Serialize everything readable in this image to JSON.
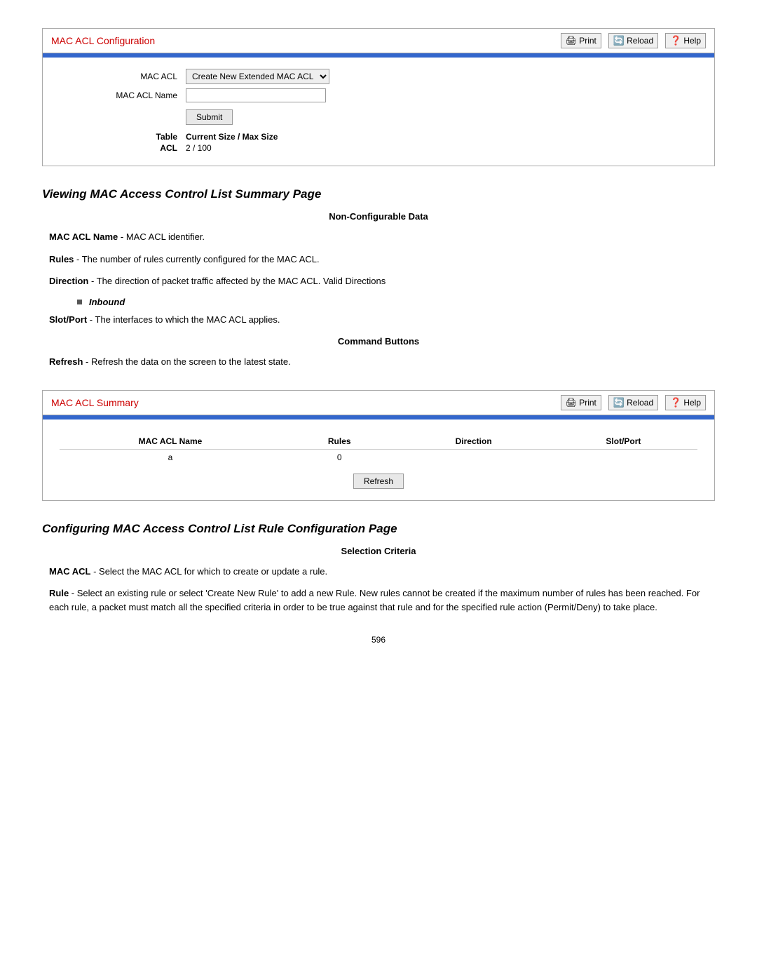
{
  "mac_acl_config_panel": {
    "title": "MAC ACL Configuration",
    "print_label": "Print",
    "reload_label": "Reload",
    "help_label": "Help",
    "mac_acl_label": "MAC ACL",
    "mac_acl_name_label": "MAC ACL Name",
    "mac_acl_select_default": "Create New Extended MAC ACL",
    "submit_label": "Submit",
    "table_label": "Table",
    "acl_label": "ACL",
    "table_header": "Current Size / Max Size",
    "table_value": "2 / 100"
  },
  "viewing_section": {
    "title": "Viewing MAC Access Control List Summary Page",
    "subtitle": "Non-Configurable Data",
    "items": [
      {
        "term": "MAC ACL Name",
        "definition": "MAC ACL identifier."
      },
      {
        "term": "Rules",
        "definition": "The number of rules currently configured for the MAC ACL."
      },
      {
        "term": "Direction",
        "definition": "The direction of packet traffic affected by the MAC ACL. Valid Directions"
      },
      {
        "term": "Slot/Port",
        "definition": "The interfaces to which the MAC ACL applies."
      }
    ],
    "bullets": [
      {
        "text": "Inbound"
      }
    ],
    "command_buttons_subtitle": "Command Buttons",
    "command_items": [
      {
        "term": "Refresh",
        "definition": "Refresh the data on the screen to the latest state."
      }
    ]
  },
  "mac_acl_summary_panel": {
    "title": "MAC ACL Summary",
    "print_label": "Print",
    "reload_label": "Reload",
    "help_label": "Help",
    "columns": [
      "MAC ACL Name",
      "Rules",
      "Direction",
      "Slot/Port"
    ],
    "rows": [
      {
        "name": "a",
        "rules": "0",
        "direction": "",
        "slot_port": ""
      }
    ],
    "refresh_label": "Refresh"
  },
  "configuring_section": {
    "title": "Configuring MAC Access Control List Rule Configuration Page",
    "subtitle": "Selection Criteria",
    "items": [
      {
        "term": "MAC ACL",
        "definition": "Select the MAC ACL for which to create or update a rule."
      },
      {
        "term": "Rule",
        "definition": "Select an existing rule or select 'Create New Rule' to add a new Rule. New rules cannot be created if the maximum number of rules has been reached. For each rule, a packet must match all the specified criteria in order to be true against that rule and for the specified rule action (Permit/Deny) to take place."
      }
    ]
  },
  "page_number": "596"
}
